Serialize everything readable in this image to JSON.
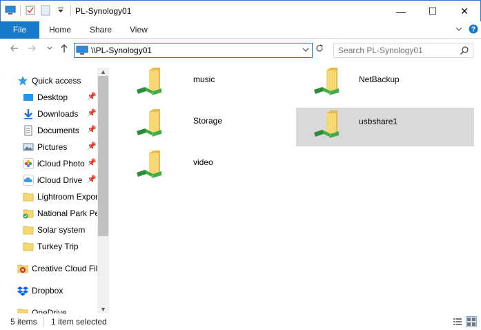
{
  "window": {
    "title": "PL-Synology01",
    "minimize": "—",
    "maximize": "☐",
    "close": "✕"
  },
  "ribbon": {
    "tabs": [
      {
        "label": "File"
      },
      {
        "label": "Home"
      },
      {
        "label": "Share"
      },
      {
        "label": "View"
      }
    ]
  },
  "address": {
    "path": "\\\\PL-Synology01",
    "search_placeholder": "Search PL-Synology01"
  },
  "nav": {
    "quick_access": "Quick access",
    "items": [
      {
        "label": "Desktop",
        "icon": "desktop-icon",
        "pinned": true
      },
      {
        "label": "Downloads",
        "icon": "downloads-icon",
        "pinned": true
      },
      {
        "label": "Documents",
        "icon": "documents-icon",
        "pinned": true
      },
      {
        "label": "Pictures",
        "icon": "pictures-icon",
        "pinned": true
      },
      {
        "label": "iCloud Photo",
        "icon": "icloud-photos-icon",
        "pinned": true
      },
      {
        "label": "iCloud Drive",
        "icon": "icloud-drive-icon",
        "pinned": true
      },
      {
        "label": "Lightroom Expor",
        "icon": "folder-icon",
        "pinned": false
      },
      {
        "label": "National Park Pe",
        "icon": "folder-synced-icon",
        "pinned": false
      },
      {
        "label": "Solar system",
        "icon": "folder-icon",
        "pinned": false
      },
      {
        "label": "Turkey Trip",
        "icon": "folder-icon",
        "pinned": false
      }
    ],
    "creative_cloud": "Creative Cloud Fil",
    "dropbox": "Dropbox",
    "onedrive": "OneDrive"
  },
  "content": {
    "items": [
      {
        "name": "music",
        "selected": false
      },
      {
        "name": "NetBackup",
        "selected": false
      },
      {
        "name": "Storage",
        "selected": false
      },
      {
        "name": "usbshare1",
        "selected": true
      },
      {
        "name": "video",
        "selected": false
      }
    ]
  },
  "status": {
    "count": "5 items",
    "selection": "1 item selected"
  },
  "colors": {
    "accent": "#1979ca",
    "folder": "#f8d775",
    "share": "#3fae49",
    "selection": "#d9d9d9"
  }
}
